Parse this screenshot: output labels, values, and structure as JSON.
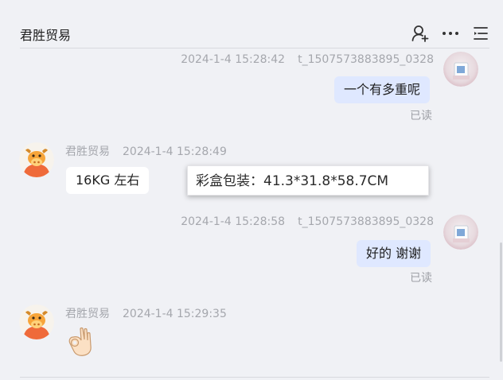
{
  "header": {
    "title": "君胜贸易",
    "icons": [
      "add-user-icon",
      "more-icon",
      "menu-icon"
    ]
  },
  "messages": [
    {
      "direction": "out",
      "sender": "t_1507573883895_0328",
      "time": "2024-1-4 15:28:42",
      "text": "一个有多重呢",
      "status": "已读"
    },
    {
      "direction": "in",
      "sender": "君胜贸易",
      "time": "2024-1-4 15:28:49",
      "text": "16KG 左右"
    },
    {
      "direction": "out",
      "sender": "t_1507573883895_0328",
      "time": "2024-1-4 15:28:58",
      "text": "好的 谢谢",
      "status": "已读"
    },
    {
      "direction": "in",
      "sender": "君胜贸易",
      "time": "2024-1-4 15:29:35",
      "emoji": "ok-hand"
    }
  ],
  "tooltip": {
    "text": "彩盒包装：41.3*31.8*58.7CM"
  },
  "colors": {
    "background": "#f0f1f5",
    "outgoing_bubble": "#dfe8ff",
    "incoming_bubble": "#ffffff",
    "meta_text": "#a5a7ad"
  }
}
